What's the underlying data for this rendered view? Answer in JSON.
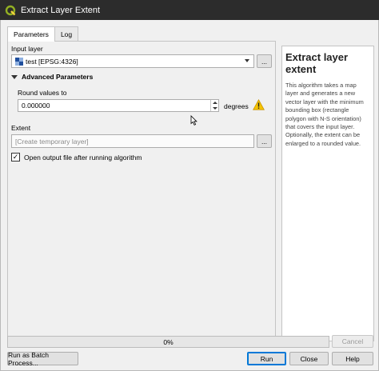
{
  "window": {
    "title": "Extract Layer Extent",
    "icon": "qgis-logo-icon",
    "accent_color": "#0078d7"
  },
  "tabs": [
    {
      "label": "Parameters",
      "active": true
    },
    {
      "label": "Log",
      "active": false
    }
  ],
  "input_layer": {
    "label": "Input layer",
    "value": "test [EPSG:4326]",
    "icon": "polygon-layer-icon",
    "browse_label": "..."
  },
  "advanced": {
    "header": "Advanced Parameters",
    "expanded": true,
    "round_label": "Round values to",
    "round_value": "0.000000",
    "unit": "degrees",
    "warning_icon": "warning-icon"
  },
  "extent": {
    "label": "Extent",
    "placeholder": "[Create temporary layer]",
    "browse_label": "..."
  },
  "open_output": {
    "label": "Open output file after running algorithm",
    "checked": true
  },
  "help": {
    "title": "Extract layer extent",
    "text": "This algorithm takes a map layer and generates a new vector layer with the minimum bounding box (rectangle polygon with N-S orientation) that covers the input layer. Optionally, the extent can be enlarged to a rounded value."
  },
  "progress": {
    "value": 0,
    "text": "0%"
  },
  "buttons": {
    "cancel": "Cancel",
    "batch": "Run as Batch Process...",
    "run": "Run",
    "close": "Close",
    "help": "Help"
  }
}
